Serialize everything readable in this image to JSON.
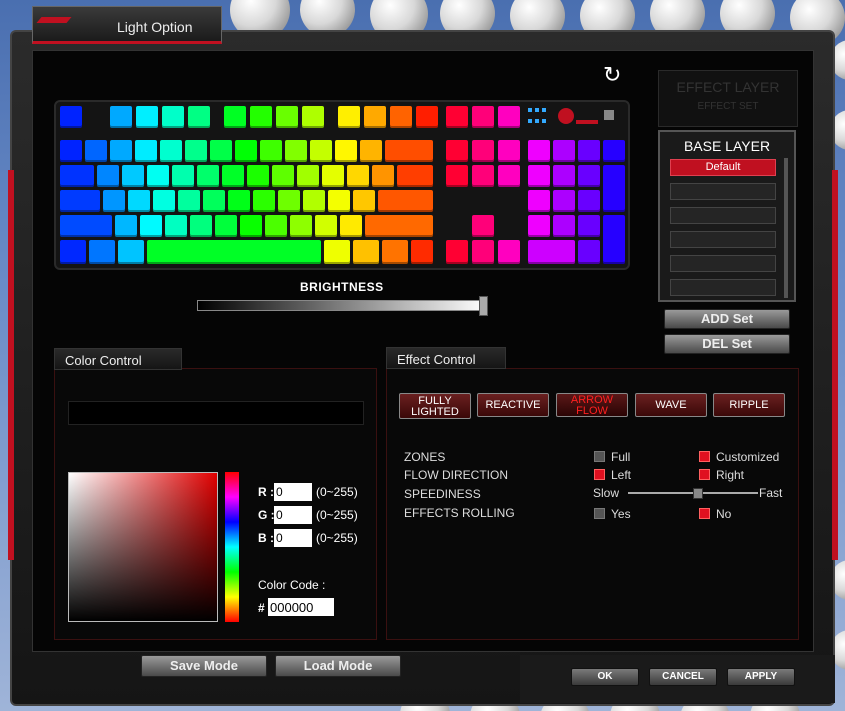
{
  "window": {
    "title": "Light Option"
  },
  "brightness": {
    "label": "BRIGHTNESS"
  },
  "layers": {
    "effect_title": "EFFECT LAYER",
    "effect_sub": "EFFECT SET",
    "base_title": "BASE LAYER",
    "slots": [
      "Default",
      "",
      "",
      "",
      "",
      ""
    ]
  },
  "set_buttons": {
    "add": "ADD Set",
    "del": "DEL Set"
  },
  "color_control": {
    "title": "Color Control",
    "r_label": "R :",
    "g_label": "G :",
    "b_label": "B :",
    "r": "0",
    "g": "0",
    "b": "0",
    "range": "(0~255)",
    "code_label": "Color Code :",
    "hash": "#",
    "code": "000000"
  },
  "effect_control": {
    "title": "Effect Control",
    "modes": [
      "FULLY LIGHTED",
      "REACTIVE",
      "ARROW FLOW",
      "WAVE",
      "RIPPLE"
    ],
    "zones_label": "ZONES",
    "zones_a": "Full",
    "zones_b": "Customized",
    "flow_label": "FLOW DIRECTION",
    "flow_a": "Left",
    "flow_b": "Right",
    "speed_label": "SPEEDINESS",
    "speed_slow": "Slow",
    "speed_fast": "Fast",
    "rolling_label": "EFFECTS ROLLING",
    "rolling_a": "Yes",
    "rolling_b": "No"
  },
  "mode_buttons": {
    "save": "Save Mode",
    "load": "Load Mode"
  },
  "dialog_buttons": {
    "ok": "OK",
    "cancel": "CANCEL",
    "apply": "APPLY"
  },
  "colors": {
    "accent": "#c01020",
    "active_check": "#e01020"
  }
}
